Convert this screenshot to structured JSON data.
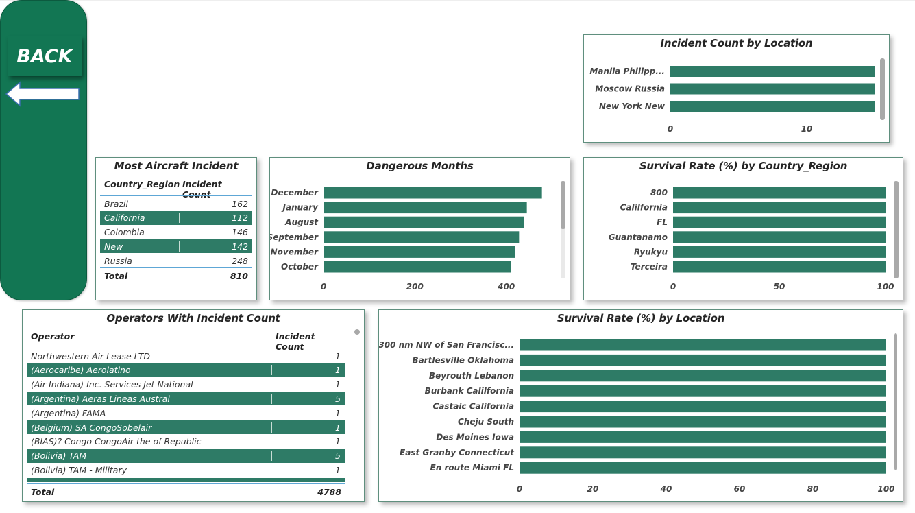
{
  "nav": {
    "back_label": "BACK"
  },
  "icons": {
    "back_arrow": "left-arrow-icon"
  },
  "colors": {
    "accent": "#127653",
    "bar": "#2e7b66"
  },
  "location_chart": {
    "title": "Incident Count by Location",
    "type": "bar",
    "categories": [
      "Manila Philipp...",
      "Moscow Russia",
      "New York New"
    ],
    "values": [
      15,
      15,
      15
    ],
    "ticks": [
      "0",
      "10"
    ]
  },
  "most_incident": {
    "title": "Most Aircraft Incident",
    "col1": "Country_Region",
    "col2": "Incident Count",
    "rows": [
      {
        "name": "Brazil",
        "count": "162"
      },
      {
        "name": "California",
        "count": "112"
      },
      {
        "name": "Colombia",
        "count": "146"
      },
      {
        "name": "New",
        "count": "142"
      },
      {
        "name": "Russia",
        "count": "248"
      }
    ],
    "total_label": "Total",
    "total_value": "810"
  },
  "months_chart": {
    "title": "Dangerous Months",
    "type": "bar",
    "categories": [
      "December",
      "January",
      "August",
      "September",
      "November",
      "October"
    ],
    "values": [
      478,
      445,
      439,
      428,
      420,
      411
    ],
    "ticks": [
      "0",
      "200",
      "400"
    ]
  },
  "survival_country_chart": {
    "title": "Survival Rate (%) by Country_Region",
    "type": "bar",
    "categories": [
      "800",
      "Calilfornia",
      "FL",
      "Guantanamo",
      "Ryukyu",
      "Terceira"
    ],
    "values": [
      100,
      100,
      100,
      100,
      100,
      100
    ],
    "ticks": [
      "0",
      "50",
      "100"
    ]
  },
  "operators": {
    "title": "Operators With Incident Count",
    "col1": "Operator",
    "col2": "Incident Count",
    "rows": [
      {
        "name": "Northwestern Air Lease LTD",
        "count": "1"
      },
      {
        "name": "(Aerocaribe) Aerolatino",
        "count": "1"
      },
      {
        "name": "(Air Indiana) Inc. Services Jet National",
        "count": "1"
      },
      {
        "name": "(Argentina) Aeras Lineas Austral",
        "count": "5"
      },
      {
        "name": "(Argentina) FAMA",
        "count": "1"
      },
      {
        "name": "(Belgium) SA CongoSobelair",
        "count": "1"
      },
      {
        "name": "(BIAS)? Congo CongoAir the of Republic",
        "count": "1"
      },
      {
        "name": "(Bolivia) TAM",
        "count": "5"
      },
      {
        "name": "(Bolivia) TAM - Military",
        "count": "1"
      }
    ],
    "total_label": "Total",
    "total_value": "4788"
  },
  "survival_location_chart": {
    "title": "Survival Rate (%) by Location",
    "type": "bar",
    "categories": [
      "300 nm NW of San Francisc...",
      "Bartlesville Oklahoma",
      "Beyrouth Lebanon",
      "Burbank Calilfornia",
      "Castaic California",
      "Cheju South",
      "Des Moines Iowa",
      "East Granby Connecticut",
      "En route Miami FL"
    ],
    "values": [
      100,
      100,
      100,
      100,
      100,
      100,
      100,
      100,
      100
    ],
    "ticks": [
      "0",
      "20",
      "40",
      "60",
      "80",
      "100"
    ]
  }
}
